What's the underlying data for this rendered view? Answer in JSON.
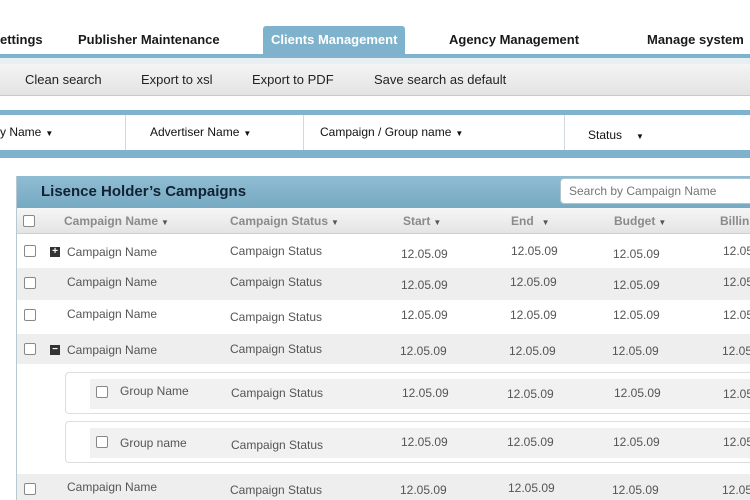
{
  "nav": {
    "tabs": [
      {
        "label": "ettings"
      },
      {
        "label": "Publisher Maintenance"
      },
      {
        "label": "Clients Management",
        "active": true
      },
      {
        "label": "Agency Management"
      },
      {
        "label": "Manage system"
      }
    ]
  },
  "toolbar": {
    "clean_search": "Clean search",
    "export_xsl": "Export to xsl",
    "export_pdf": "Export to PDF",
    "save_default": "Save search as default"
  },
  "filters": [
    {
      "label": "y Name"
    },
    {
      "label": "Advertiser Name"
    },
    {
      "label": "Campaign / Group name"
    },
    {
      "label": "Status"
    }
  ],
  "panel": {
    "title": "Lisence Holder’s Campaigns",
    "search_placeholder": "Search by Campaign Name"
  },
  "columns": {
    "campaign_name": "Campaign Name",
    "campaign_status": "Campaign Status",
    "start": "Start",
    "end": "End",
    "budget": "Budget",
    "billing": "Billin"
  },
  "rows": [
    {
      "name": "Campaign Name",
      "status": "Campaign Status",
      "start": "12.05.09",
      "end": "12.05.09",
      "budget": "12.05.09",
      "billing": "12.05",
      "toggle": "+"
    },
    {
      "name": "Campaign Name",
      "status": "Campaign Status",
      "start": "12.05.09",
      "end": "12.05.09",
      "budget": "12.05.09",
      "billing": "12.05"
    },
    {
      "name": "Campaign Name",
      "status": "Campaign Status",
      "start": "12.05.09",
      "end": "12.05.09",
      "budget": "12.05.09",
      "billing": "12.05"
    },
    {
      "name": "Campaign Name",
      "status": "Campaign Status",
      "start": "12.05.09",
      "end": "12.05.09",
      "budget": "12.05.09",
      "billing": "12.05",
      "toggle": "−"
    },
    {
      "name": "Campaign Name",
      "status": "Campaign Status",
      "start": "12.05.09",
      "end": "12.05.09",
      "budget": "12.05.09",
      "billing": "12.05"
    }
  ],
  "groups": [
    {
      "name": "Group Name",
      "status": "Campaign Status",
      "start": "12.05.09",
      "end": "12.05.09",
      "budget": "12.05.09",
      "billing": "12.05"
    },
    {
      "name": "Group name",
      "status": "Campaign Status",
      "start": "12.05.09",
      "end": "12.05.09",
      "budget": "12.05.09",
      "billing": "12.05"
    }
  ],
  "colors": {
    "accent": "#7fb2cc",
    "header_text": "#123344",
    "row_alt": "#eeeeee"
  }
}
